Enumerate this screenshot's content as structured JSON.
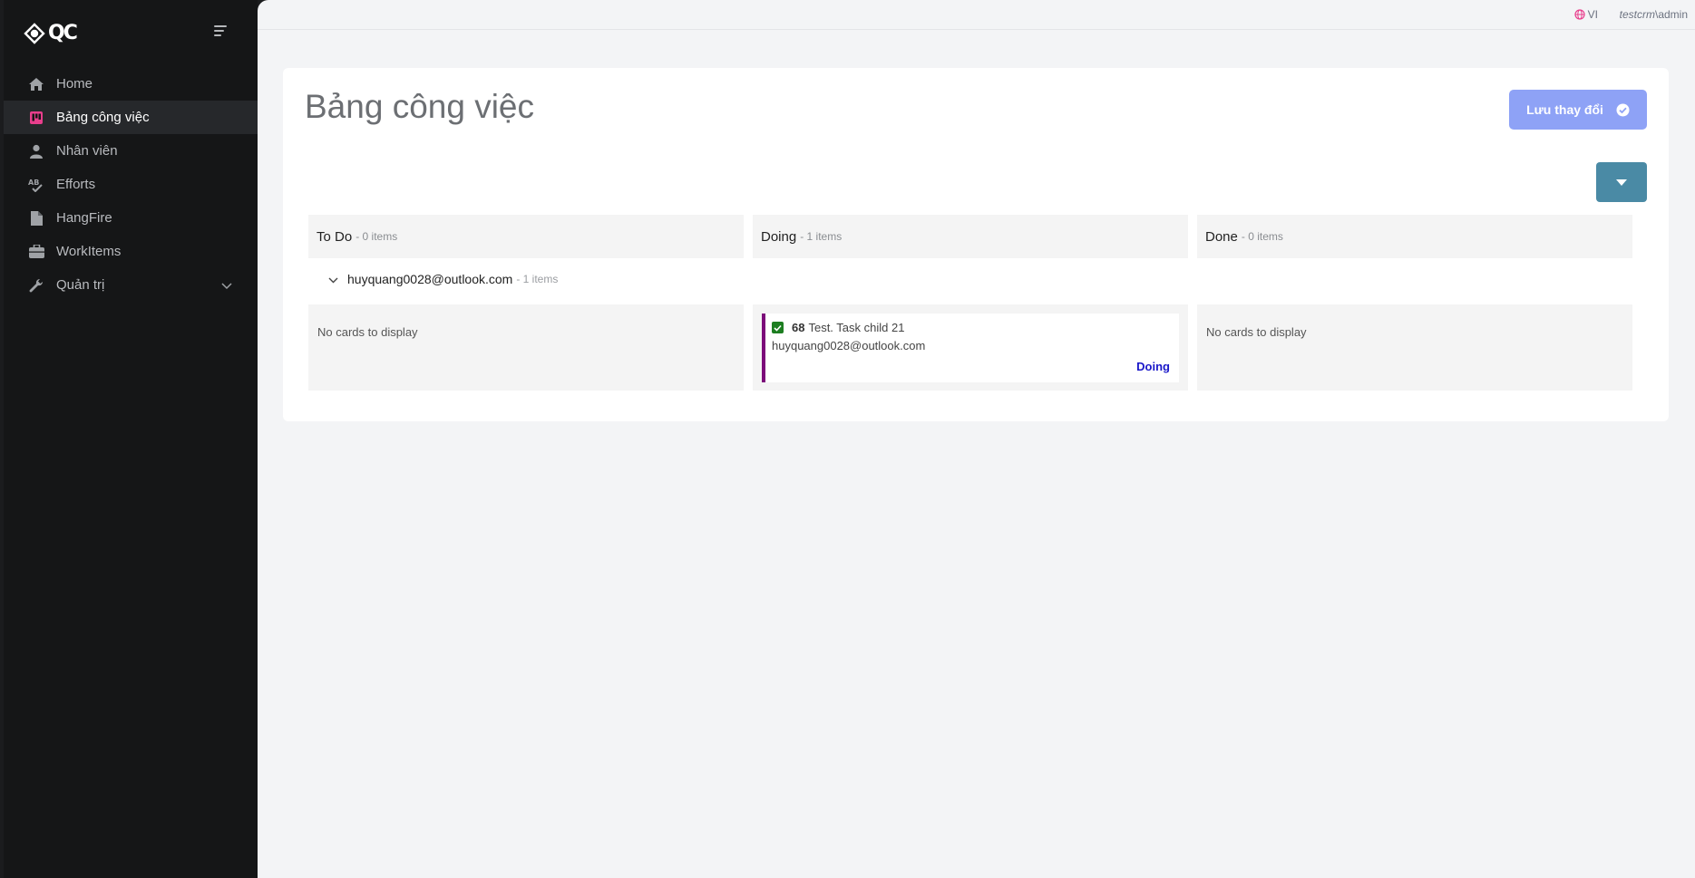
{
  "app": {
    "logo_text": "QC"
  },
  "sidebar": {
    "items": [
      {
        "label": "Home"
      },
      {
        "label": "Bảng công việc"
      },
      {
        "label": "Nhân viên"
      },
      {
        "label": "Efforts"
      },
      {
        "label": "HangFire"
      },
      {
        "label": "WorkItems"
      },
      {
        "label": "Quản trị"
      }
    ],
    "active_index": 1
  },
  "topbar": {
    "language": "VI",
    "user_tenant": "testcrm",
    "user_sep": "\\",
    "user_name": "admin"
  },
  "page": {
    "title": "Bảng công việc",
    "save_label": "Lưu thay đổi"
  },
  "board": {
    "columns": [
      {
        "title": "To Do",
        "count": "- 0 items"
      },
      {
        "title": "Doing",
        "count": "- 1 items"
      },
      {
        "title": "Done",
        "count": "- 0 items"
      }
    ],
    "swimlane": {
      "title": "huyquang0028@outlook.com",
      "count": "- 1 items"
    },
    "empty_text": "No cards to display",
    "cards": [
      {
        "id": "68",
        "title": "Test. Task child 21",
        "assignee": "huyquang0028@outlook.com",
        "status": "Doing"
      }
    ]
  },
  "colors": {
    "sidebar_bg": "#151617",
    "active_icon": "#e83e8c",
    "save_button": "#8ea2f6",
    "dropdown_button": "#4a8aa5",
    "card_accent": "#7c0c7a",
    "status_doing": "#1a18c9",
    "checkbox": "#1d7e21"
  }
}
